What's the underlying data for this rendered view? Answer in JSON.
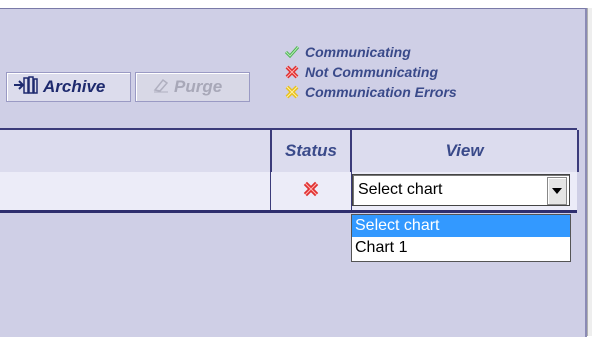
{
  "toolbar": {
    "archive_label": "Archive",
    "purge_label": "Purge"
  },
  "legend": [
    {
      "label": "Communicating",
      "icon": "check-icon",
      "color": "#4caf50"
    },
    {
      "label": "Not Communicating",
      "icon": "red-x-icon",
      "color": "#e03030"
    },
    {
      "label": "Communication Errors",
      "icon": "yellow-x-icon",
      "color": "#e8c020"
    }
  ],
  "table": {
    "headers": {
      "status": "Status",
      "view": "View"
    },
    "row": {
      "status_icon": "red-x-icon",
      "view_value": "Select chart"
    }
  },
  "dropdown": {
    "options": [
      "Select chart",
      "Chart 1"
    ],
    "selected_index": 0
  },
  "colors": {
    "panel": "#cfcfe6",
    "border": "#3b3b7a",
    "text_accent": "#3a4a8a",
    "selection": "#3399ff"
  }
}
